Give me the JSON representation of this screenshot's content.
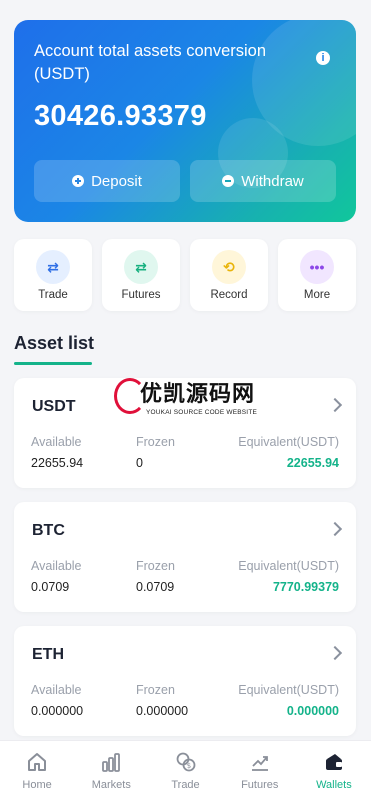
{
  "hero": {
    "title": "Account total assets conversion (USDT)",
    "info_icon": "i",
    "amount": "30426.93379",
    "deposit_label": "Deposit",
    "withdraw_label": "Withdraw"
  },
  "quick_actions": [
    {
      "label": "Trade",
      "icon": "⇄"
    },
    {
      "label": "Futures",
      "icon": "⇄"
    },
    {
      "label": "Record",
      "icon": "⟲"
    },
    {
      "label": "More",
      "icon": "•••"
    }
  ],
  "section": {
    "title": "Asset list"
  },
  "watermark": {
    "cn": "优凯源码网",
    "en": "YOUKAI SOURCE CODE WEBSITE"
  },
  "columns": {
    "available": "Available",
    "frozen": "Frozen",
    "equivalent": "Equivalent(USDT)"
  },
  "assets": [
    {
      "symbol": "USDT",
      "available": "22655.94",
      "frozen": "0",
      "equivalent": "22655.94"
    },
    {
      "symbol": "BTC",
      "available": "0.0709",
      "frozen": "0.0709",
      "equivalent": "7770.99379"
    },
    {
      "symbol": "ETH",
      "available": "0.000000",
      "frozen": "0.000000",
      "equivalent": "0.000000"
    }
  ],
  "nav": [
    {
      "label": "Home",
      "icon": "home-icon"
    },
    {
      "label": "Markets",
      "icon": "bar-chart-icon"
    },
    {
      "label": "Trade",
      "icon": "coins-icon"
    },
    {
      "label": "Futures",
      "icon": "trend-icon"
    },
    {
      "label": "Wallets",
      "icon": "wallet-icon"
    }
  ],
  "colors": {
    "accent": "#14b38a",
    "hero_start": "#1f6fea",
    "hero_end": "#10c79b"
  }
}
